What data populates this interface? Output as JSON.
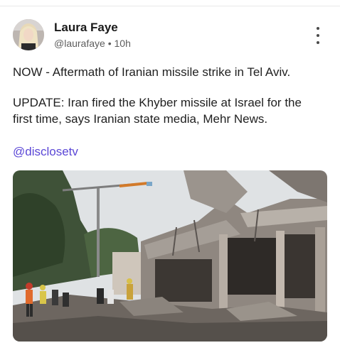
{
  "author": {
    "display_name": "Laura Faye",
    "handle": "@laurafaye",
    "separator": "•",
    "time_ago": "10h"
  },
  "post": {
    "line_1": "NOW - Aftermath of Iranian missile strike in Tel Aviv.",
    "line_2": "UPDATE: Iran fired the Khyber missile at Israel for the",
    "line_3": "first time, says Iranian state media, Mehr News.",
    "mention": "@disclosetv"
  },
  "icons": {
    "more_menu": "vertical-dots-icon"
  },
  "colors": {
    "mention": "#5b47d6",
    "text": "#1f1f1f",
    "meta": "#5d5d5d"
  }
}
